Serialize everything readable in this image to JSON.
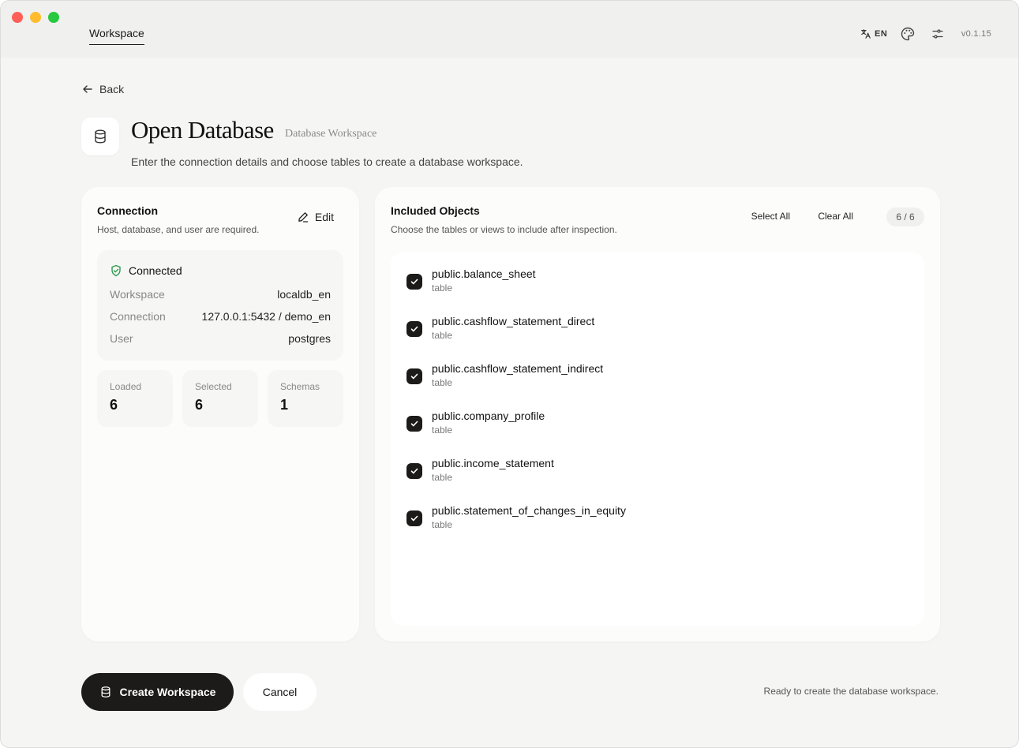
{
  "window": {
    "tab": "Workspace",
    "language": "EN",
    "version": "v0.1.15"
  },
  "nav": {
    "back_label": "Back"
  },
  "header": {
    "title": "Open Database",
    "subtitle": "Database Workspace",
    "description": "Enter the connection details and choose tables to create a database workspace."
  },
  "connection": {
    "title": "Connection",
    "subtitle": "Host, database, and user are required.",
    "edit_label": "Edit",
    "status": "Connected",
    "rows": [
      {
        "key": "Workspace",
        "value": "localdb_en"
      },
      {
        "key": "Connection",
        "value": "127.0.0.1:5432 / demo_en"
      },
      {
        "key": "User",
        "value": "postgres"
      }
    ],
    "stats": [
      {
        "label": "Loaded",
        "value": "6"
      },
      {
        "label": "Selected",
        "value": "6"
      },
      {
        "label": "Schemas",
        "value": "1"
      }
    ]
  },
  "objects": {
    "title": "Included Objects",
    "subtitle": "Choose the tables or views to include after inspection.",
    "select_all_label": "Select All",
    "clear_all_label": "Clear All",
    "count": "6 / 6",
    "items": [
      {
        "name": "public.balance_sheet",
        "type": "table",
        "checked": true
      },
      {
        "name": "public.cashflow_statement_direct",
        "type": "table",
        "checked": true
      },
      {
        "name": "public.cashflow_statement_indirect",
        "type": "table",
        "checked": true
      },
      {
        "name": "public.company_profile",
        "type": "table",
        "checked": true
      },
      {
        "name": "public.income_statement",
        "type": "table",
        "checked": true
      },
      {
        "name": "public.statement_of_changes_in_equity",
        "type": "table",
        "checked": true
      }
    ]
  },
  "footer": {
    "create_label": "Create Workspace",
    "cancel_label": "Cancel",
    "status": "Ready to create the database workspace."
  },
  "colors": {
    "accent": "#1c1b1a",
    "connected": "#2e9b4f",
    "background": "#f5f5f4"
  }
}
